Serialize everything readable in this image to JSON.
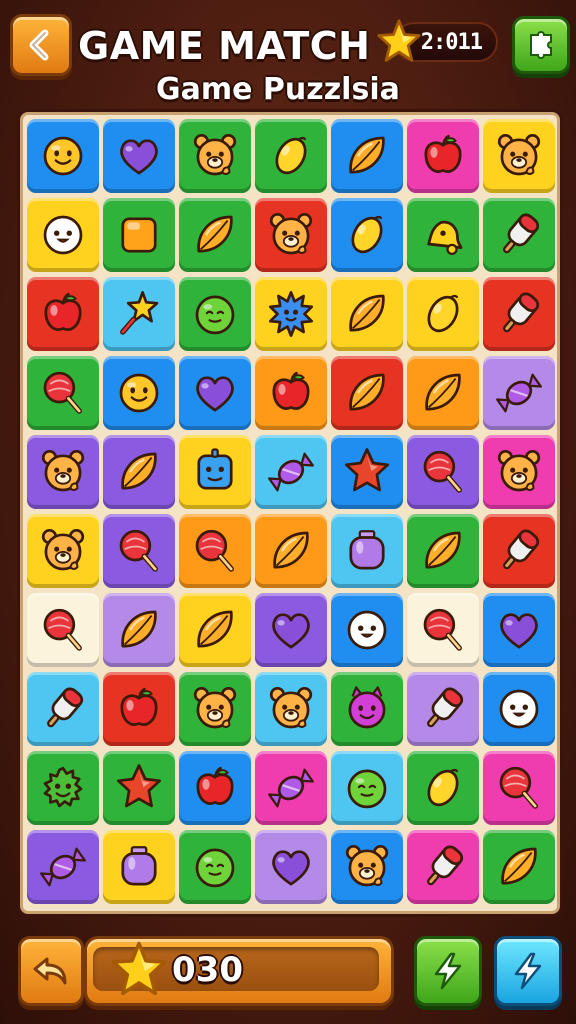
{
  "header": {
    "title": "GAME MATCH",
    "subtitle": "Game Puzzlsia",
    "timer": "2:011",
    "back_icon": "back-arrow-icon",
    "timer_icon": "star-icon",
    "menu_icon": "puzzle-icon"
  },
  "footer": {
    "score": "030",
    "undo_icon": "undo-arrow-icon",
    "score_icon": "star-icon",
    "boost1_icon": "lightning-icon",
    "boost2_icon": "lightning-icon"
  },
  "colors": {
    "blue": "#1f8ef0",
    "green": "#2fb33a",
    "yellow": "#ffd21f",
    "red": "#e63322",
    "orange": "#ff9a18",
    "purple": "#8a5ae0",
    "pink": "#ef3db0",
    "cyan": "#4fc6f2",
    "cream": "#fbf3dc",
    "lavender": "#b48ae8",
    "lime": "#7fd13a"
  },
  "board": {
    "rows": [
      [
        {
          "bg": "blue",
          "icon": "smiley-face-icon"
        },
        {
          "bg": "blue",
          "icon": "heart-icon"
        },
        {
          "bg": "green",
          "icon": "bear-icon"
        },
        {
          "bg": "green",
          "icon": "lemon-icon"
        },
        {
          "bg": "blue",
          "icon": "leaf-icon"
        },
        {
          "bg": "pink",
          "icon": "apple-icon"
        },
        {
          "bg": "yellow",
          "icon": "bear-icon"
        }
      ],
      [
        {
          "bg": "yellow",
          "icon": "ghost-face-icon"
        },
        {
          "bg": "green",
          "icon": "square-gem-icon"
        },
        {
          "bg": "green",
          "icon": "leaf-icon"
        },
        {
          "bg": "red",
          "icon": "bear-icon"
        },
        {
          "bg": "blue",
          "icon": "lemon-icon"
        },
        {
          "bg": "green",
          "icon": "bell-icon"
        },
        {
          "bg": "green",
          "icon": "popsicle-icon"
        }
      ],
      [
        {
          "bg": "red",
          "icon": "apple-icon"
        },
        {
          "bg": "cyan",
          "icon": "star-wand-icon"
        },
        {
          "bg": "green",
          "icon": "slime-face-icon"
        },
        {
          "bg": "yellow",
          "icon": "spiky-ball-icon"
        },
        {
          "bg": "yellow",
          "icon": "leaf-icon"
        },
        {
          "bg": "yellow",
          "icon": "lemon-icon"
        },
        {
          "bg": "red",
          "icon": "popsicle-icon"
        }
      ],
      [
        {
          "bg": "green",
          "icon": "lollipop-icon"
        },
        {
          "bg": "blue",
          "icon": "smiley-face-icon"
        },
        {
          "bg": "blue",
          "icon": "heart-icon"
        },
        {
          "bg": "orange",
          "icon": "apple-icon"
        },
        {
          "bg": "red",
          "icon": "leaf-icon"
        },
        {
          "bg": "orange",
          "icon": "leaf-icon"
        },
        {
          "bg": "lavender",
          "icon": "candy-icon"
        }
      ],
      [
        {
          "bg": "purple",
          "icon": "bear-icon"
        },
        {
          "bg": "purple",
          "icon": "leaf-icon"
        },
        {
          "bg": "yellow",
          "icon": "robot-face-icon"
        },
        {
          "bg": "cyan",
          "icon": "candy-icon"
        },
        {
          "bg": "blue",
          "icon": "star-icon"
        },
        {
          "bg": "purple",
          "icon": "lollipop-icon"
        },
        {
          "bg": "pink",
          "icon": "bear-icon"
        }
      ],
      [
        {
          "bg": "yellow",
          "icon": "bear-icon"
        },
        {
          "bg": "purple",
          "icon": "lollipop-icon"
        },
        {
          "bg": "orange",
          "icon": "lollipop-icon"
        },
        {
          "bg": "orange",
          "icon": "leaf-icon"
        },
        {
          "bg": "cyan",
          "icon": "jar-icon"
        },
        {
          "bg": "green",
          "icon": "leaf-icon"
        },
        {
          "bg": "red",
          "icon": "popsicle-icon"
        }
      ],
      [
        {
          "bg": "cream",
          "icon": "lollipop-icon"
        },
        {
          "bg": "lavender",
          "icon": "leaf-icon"
        },
        {
          "bg": "yellow",
          "icon": "leaf-icon"
        },
        {
          "bg": "purple",
          "icon": "heart-icon"
        },
        {
          "bg": "blue",
          "icon": "ghost-face-icon"
        },
        {
          "bg": "cream",
          "icon": "lollipop-icon"
        },
        {
          "bg": "blue",
          "icon": "heart-icon"
        }
      ],
      [
        {
          "bg": "cyan",
          "icon": "popsicle-icon"
        },
        {
          "bg": "red",
          "icon": "apple-icon"
        },
        {
          "bg": "green",
          "icon": "bear-icon"
        },
        {
          "bg": "cyan",
          "icon": "bear-icon"
        },
        {
          "bg": "green",
          "icon": "devil-face-icon"
        },
        {
          "bg": "lavender",
          "icon": "popsicle-icon"
        },
        {
          "bg": "blue",
          "icon": "ghost-face-icon"
        }
      ],
      [
        {
          "bg": "green",
          "icon": "monster-face-icon"
        },
        {
          "bg": "green",
          "icon": "star-icon"
        },
        {
          "bg": "blue",
          "icon": "apple-icon"
        },
        {
          "bg": "pink",
          "icon": "candy-icon"
        },
        {
          "bg": "cyan",
          "icon": "slime-face-icon"
        },
        {
          "bg": "green",
          "icon": "lemon-icon"
        },
        {
          "bg": "pink",
          "icon": "lollipop-icon"
        }
      ],
      [
        {
          "bg": "purple",
          "icon": "candy-icon"
        },
        {
          "bg": "yellow",
          "icon": "jar-icon"
        },
        {
          "bg": "green",
          "icon": "slime-face-icon"
        },
        {
          "bg": "lavender",
          "icon": "heart-icon"
        },
        {
          "bg": "blue",
          "icon": "bear-icon"
        },
        {
          "bg": "pink",
          "icon": "popsicle-icon"
        },
        {
          "bg": "green",
          "icon": "leaf-icon"
        }
      ]
    ]
  }
}
